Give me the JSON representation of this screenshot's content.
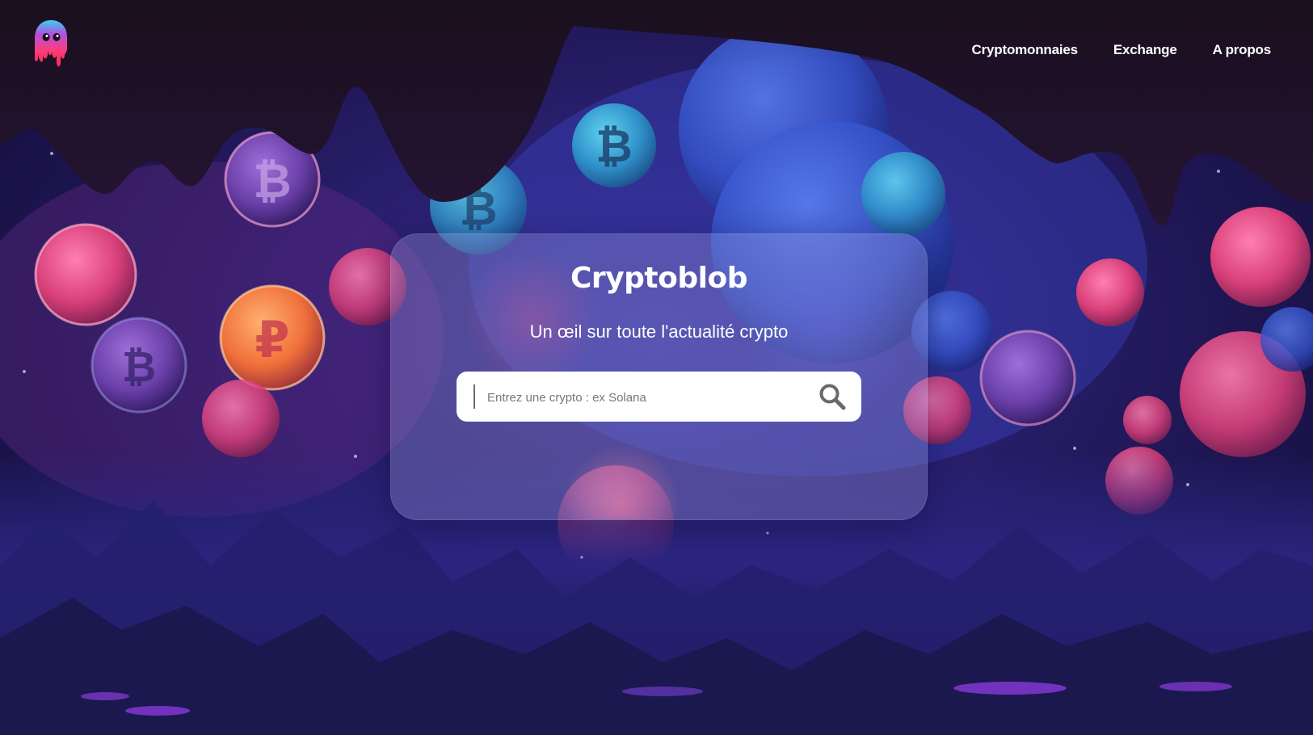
{
  "nav": {
    "items": [
      {
        "label": "Cryptomonnaies"
      },
      {
        "label": "Exchange"
      },
      {
        "label": "A propos"
      }
    ]
  },
  "hero": {
    "title": "Cryptoblob",
    "tagline": "Un œil sur toute l'actualité crypto"
  },
  "search": {
    "placeholder": "Entrez une crypto : ex Solana",
    "value": "",
    "icon": "search-icon"
  },
  "logo": {
    "icon": "blob-logo-icon"
  },
  "colors": {
    "accent_pink": "#ff4d8d",
    "background_deep": "#1d1550",
    "drip_dark": "#1a0f22",
    "text": "#ffffff"
  }
}
